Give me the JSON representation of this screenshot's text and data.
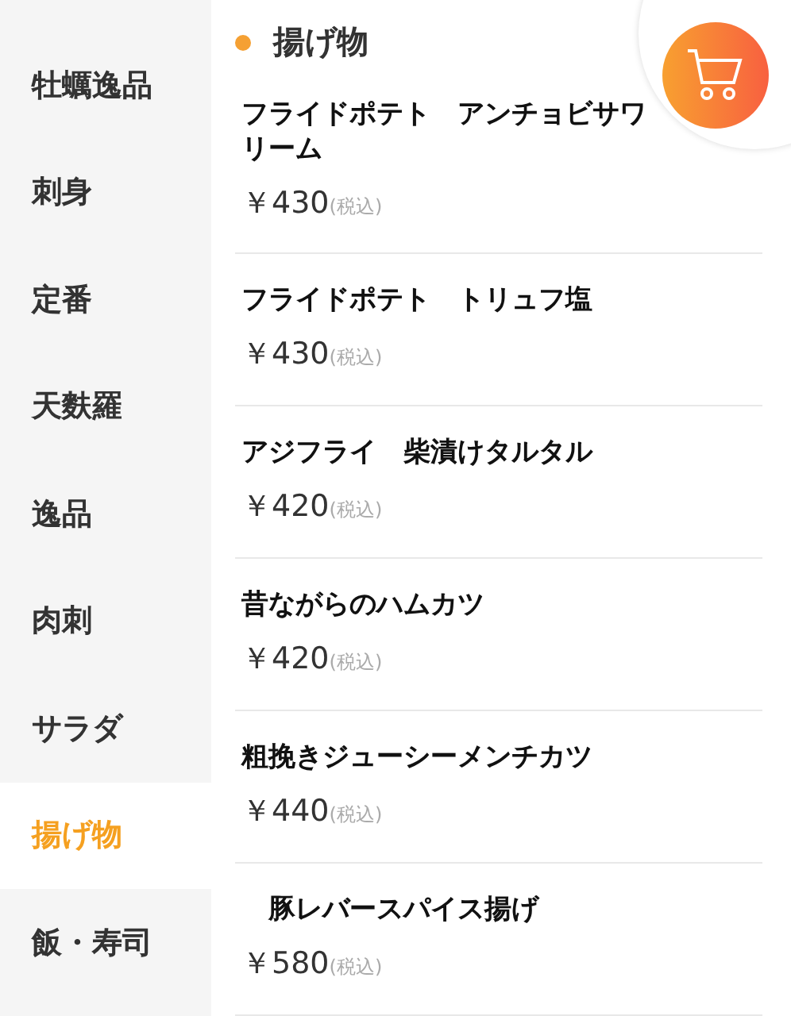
{
  "categories": [
    {
      "label": "牡蠣逸品",
      "selected": false
    },
    {
      "label": "刺身",
      "selected": false
    },
    {
      "label": "定番",
      "selected": false
    },
    {
      "label": "天麩羅",
      "selected": false
    },
    {
      "label": "逸品",
      "selected": false
    },
    {
      "label": "肉刺",
      "selected": false
    },
    {
      "label": "サラダ",
      "selected": false
    },
    {
      "label": "揚げ物",
      "selected": true
    },
    {
      "label": "飯・寿司",
      "selected": false
    }
  ],
  "section": {
    "title": "揚げ物"
  },
  "items": [
    {
      "name_lines": [
        "フライドポテト　アンチョビサワ",
        "リーム"
      ],
      "price": "￥430",
      "tax": "(税込)"
    },
    {
      "name_lines": [
        "フライドポテト　トリュフ塩"
      ],
      "price": "￥430",
      "tax": "(税込)"
    },
    {
      "name_lines": [
        "アジフライ　柴漬けタルタル"
      ],
      "price": "￥420",
      "tax": "(税込)"
    },
    {
      "name_lines": [
        "昔ながらのハムカツ"
      ],
      "price": "￥420",
      "tax": "(税込)"
    },
    {
      "name_lines": [
        "粗挽きジューシーメンチカツ"
      ],
      "price": "￥440",
      "tax": "(税込)"
    },
    {
      "name_lines": [
        "　豚レバースパイス揚げ"
      ],
      "price": "￥580",
      "tax": "(税込)"
    }
  ]
}
